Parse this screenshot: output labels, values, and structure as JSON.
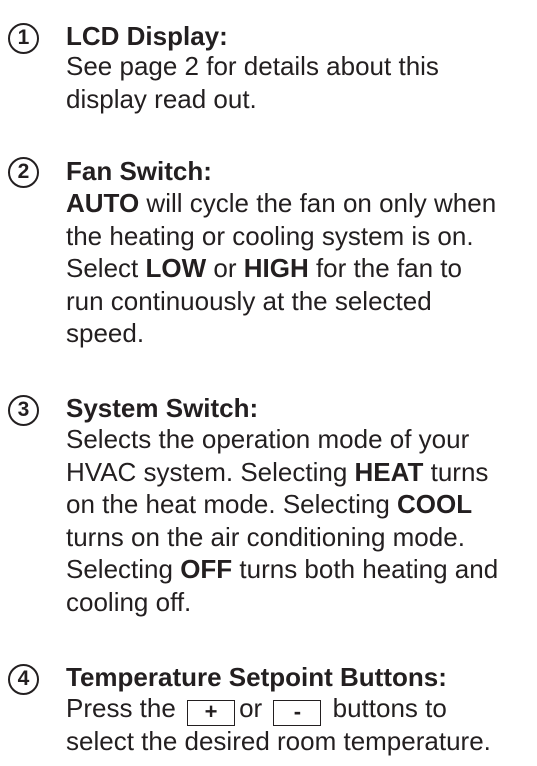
{
  "items": [
    {
      "number": "1",
      "title": "LCD Display:",
      "lines": [
        [
          "See page 2 for details about this"
        ],
        [
          "display read out."
        ]
      ]
    },
    {
      "number": "2",
      "title": "Fan Switch:",
      "lines": [
        [
          {
            "b": "AUTO"
          },
          " will cycle the fan on only when"
        ],
        [
          "the heating or cooling system is on."
        ],
        [
          "Select ",
          {
            "b": "LOW"
          },
          " or ",
          {
            "b": "HIGH"
          },
          " for the fan to"
        ],
        [
          "run continuously at the selected"
        ],
        [
          "speed."
        ]
      ]
    },
    {
      "number": "3",
      "title": "System Switch:",
      "lines": [
        [
          "Selects the operation mode of your"
        ],
        [
          "HVAC system. Selecting ",
          {
            "b": "HEAT"
          },
          " turns"
        ],
        [
          "on the heat mode. Selecting ",
          {
            "b": "COOL"
          }
        ],
        [
          "turns on the air conditioning mode."
        ],
        [
          "Selecting ",
          {
            "b": "OFF"
          },
          " turns both heating and"
        ],
        [
          "cooling off."
        ]
      ]
    },
    {
      "number": "4",
      "title": "Temperature Setpoint Buttons:",
      "lines": [
        [
          "Press the ",
          {
            "key": "+"
          },
          "or ",
          {
            "key": "-"
          },
          " buttons to"
        ],
        [
          "select the desired room temperature."
        ]
      ]
    }
  ]
}
